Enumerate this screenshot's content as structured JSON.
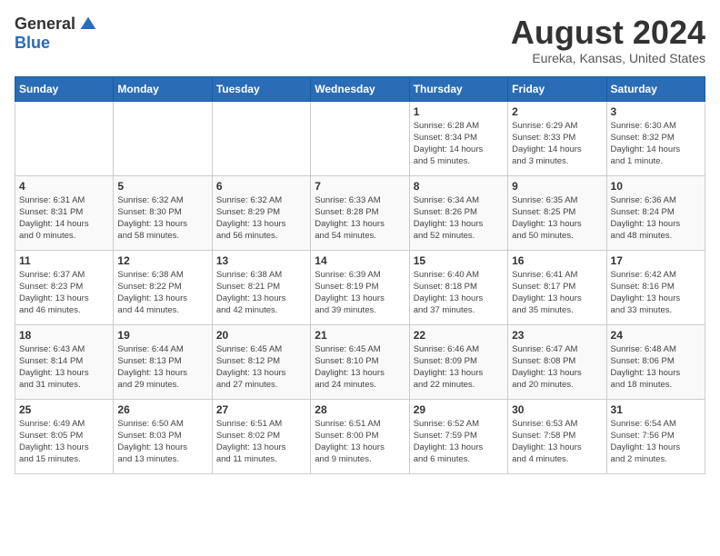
{
  "logo": {
    "general": "General",
    "blue": "Blue"
  },
  "title": "August 2024",
  "location": "Eureka, Kansas, United States",
  "days_of_week": [
    "Sunday",
    "Monday",
    "Tuesday",
    "Wednesday",
    "Thursday",
    "Friday",
    "Saturday"
  ],
  "weeks": [
    [
      {
        "num": "",
        "detail": ""
      },
      {
        "num": "",
        "detail": ""
      },
      {
        "num": "",
        "detail": ""
      },
      {
        "num": "",
        "detail": ""
      },
      {
        "num": "1",
        "detail": "Sunrise: 6:28 AM\nSunset: 8:34 PM\nDaylight: 14 hours\nand 5 minutes."
      },
      {
        "num": "2",
        "detail": "Sunrise: 6:29 AM\nSunset: 8:33 PM\nDaylight: 14 hours\nand 3 minutes."
      },
      {
        "num": "3",
        "detail": "Sunrise: 6:30 AM\nSunset: 8:32 PM\nDaylight: 14 hours\nand 1 minute."
      }
    ],
    [
      {
        "num": "4",
        "detail": "Sunrise: 6:31 AM\nSunset: 8:31 PM\nDaylight: 14 hours\nand 0 minutes."
      },
      {
        "num": "5",
        "detail": "Sunrise: 6:32 AM\nSunset: 8:30 PM\nDaylight: 13 hours\nand 58 minutes."
      },
      {
        "num": "6",
        "detail": "Sunrise: 6:32 AM\nSunset: 8:29 PM\nDaylight: 13 hours\nand 56 minutes."
      },
      {
        "num": "7",
        "detail": "Sunrise: 6:33 AM\nSunset: 8:28 PM\nDaylight: 13 hours\nand 54 minutes."
      },
      {
        "num": "8",
        "detail": "Sunrise: 6:34 AM\nSunset: 8:26 PM\nDaylight: 13 hours\nand 52 minutes."
      },
      {
        "num": "9",
        "detail": "Sunrise: 6:35 AM\nSunset: 8:25 PM\nDaylight: 13 hours\nand 50 minutes."
      },
      {
        "num": "10",
        "detail": "Sunrise: 6:36 AM\nSunset: 8:24 PM\nDaylight: 13 hours\nand 48 minutes."
      }
    ],
    [
      {
        "num": "11",
        "detail": "Sunrise: 6:37 AM\nSunset: 8:23 PM\nDaylight: 13 hours\nand 46 minutes."
      },
      {
        "num": "12",
        "detail": "Sunrise: 6:38 AM\nSunset: 8:22 PM\nDaylight: 13 hours\nand 44 minutes."
      },
      {
        "num": "13",
        "detail": "Sunrise: 6:38 AM\nSunset: 8:21 PM\nDaylight: 13 hours\nand 42 minutes."
      },
      {
        "num": "14",
        "detail": "Sunrise: 6:39 AM\nSunset: 8:19 PM\nDaylight: 13 hours\nand 39 minutes."
      },
      {
        "num": "15",
        "detail": "Sunrise: 6:40 AM\nSunset: 8:18 PM\nDaylight: 13 hours\nand 37 minutes."
      },
      {
        "num": "16",
        "detail": "Sunrise: 6:41 AM\nSunset: 8:17 PM\nDaylight: 13 hours\nand 35 minutes."
      },
      {
        "num": "17",
        "detail": "Sunrise: 6:42 AM\nSunset: 8:16 PM\nDaylight: 13 hours\nand 33 minutes."
      }
    ],
    [
      {
        "num": "18",
        "detail": "Sunrise: 6:43 AM\nSunset: 8:14 PM\nDaylight: 13 hours\nand 31 minutes."
      },
      {
        "num": "19",
        "detail": "Sunrise: 6:44 AM\nSunset: 8:13 PM\nDaylight: 13 hours\nand 29 minutes."
      },
      {
        "num": "20",
        "detail": "Sunrise: 6:45 AM\nSunset: 8:12 PM\nDaylight: 13 hours\nand 27 minutes."
      },
      {
        "num": "21",
        "detail": "Sunrise: 6:45 AM\nSunset: 8:10 PM\nDaylight: 13 hours\nand 24 minutes."
      },
      {
        "num": "22",
        "detail": "Sunrise: 6:46 AM\nSunset: 8:09 PM\nDaylight: 13 hours\nand 22 minutes."
      },
      {
        "num": "23",
        "detail": "Sunrise: 6:47 AM\nSunset: 8:08 PM\nDaylight: 13 hours\nand 20 minutes."
      },
      {
        "num": "24",
        "detail": "Sunrise: 6:48 AM\nSunset: 8:06 PM\nDaylight: 13 hours\nand 18 minutes."
      }
    ],
    [
      {
        "num": "25",
        "detail": "Sunrise: 6:49 AM\nSunset: 8:05 PM\nDaylight: 13 hours\nand 15 minutes."
      },
      {
        "num": "26",
        "detail": "Sunrise: 6:50 AM\nSunset: 8:03 PM\nDaylight: 13 hours\nand 13 minutes."
      },
      {
        "num": "27",
        "detail": "Sunrise: 6:51 AM\nSunset: 8:02 PM\nDaylight: 13 hours\nand 11 minutes."
      },
      {
        "num": "28",
        "detail": "Sunrise: 6:51 AM\nSunset: 8:00 PM\nDaylight: 13 hours\nand 9 minutes."
      },
      {
        "num": "29",
        "detail": "Sunrise: 6:52 AM\nSunset: 7:59 PM\nDaylight: 13 hours\nand 6 minutes."
      },
      {
        "num": "30",
        "detail": "Sunrise: 6:53 AM\nSunset: 7:58 PM\nDaylight: 13 hours\nand 4 minutes."
      },
      {
        "num": "31",
        "detail": "Sunrise: 6:54 AM\nSunset: 7:56 PM\nDaylight: 13 hours\nand 2 minutes."
      }
    ]
  ]
}
